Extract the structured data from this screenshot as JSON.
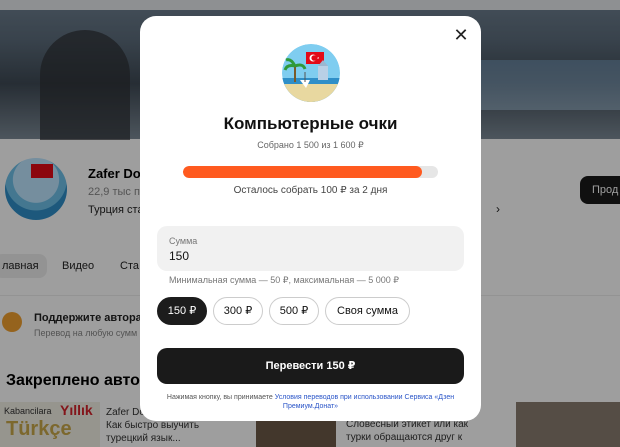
{
  "background": {
    "channel_name": "Zafer Do",
    "channel_subs": "22,9 тыс по",
    "channel_desc": "Турция ста",
    "channel_button": "Прод",
    "tabs": [
      "лавная",
      "Видео",
      "Ста"
    ],
    "donate_title": "Поддержите автора",
    "donate_sub": "Перевод на любую сумм",
    "pinned_heading": "Закреплено авто",
    "card1": {
      "top_text": "Kabancilara",
      "brand": "Yıllık",
      "word": "Türkçe"
    },
    "card1_text": [
      "Zafer Do",
      "Как быстро выучить",
      "турецкий язык..."
    ],
    "card2_text": [
      "Словесный этикет или как",
      "турки обращаются друг к"
    ]
  },
  "modal": {
    "title": "Компьютерные очки",
    "collected": "Собрано 1 500 из 1 600 ₽",
    "progress_fraction": 0.9375,
    "remaining": "Осталось собрать 100 ₽ за 2 дня",
    "amount_label": "Сумма",
    "amount_value": "150",
    "limits": "Минимальная сумма — 50 ₽, максимальная — 5 000 ₽",
    "chips": [
      {
        "label": "150 ₽",
        "active": true
      },
      {
        "label": "300 ₽",
        "active": false
      },
      {
        "label": "500 ₽",
        "active": false
      },
      {
        "label": "Своя сумма",
        "active": false
      }
    ],
    "transfer_button": "Перевести 150 ₽",
    "terms_prefix": "Нажимая кнопку, вы принимаете ",
    "terms_link": "Условия переводов при использовании Сервиса «Дзен Премиум.Донат»",
    "close_icon": "close-icon"
  },
  "colors": {
    "accent": "#ff5a1f",
    "button_dark": "#1a1a1a",
    "link": "#2a55c8"
  }
}
